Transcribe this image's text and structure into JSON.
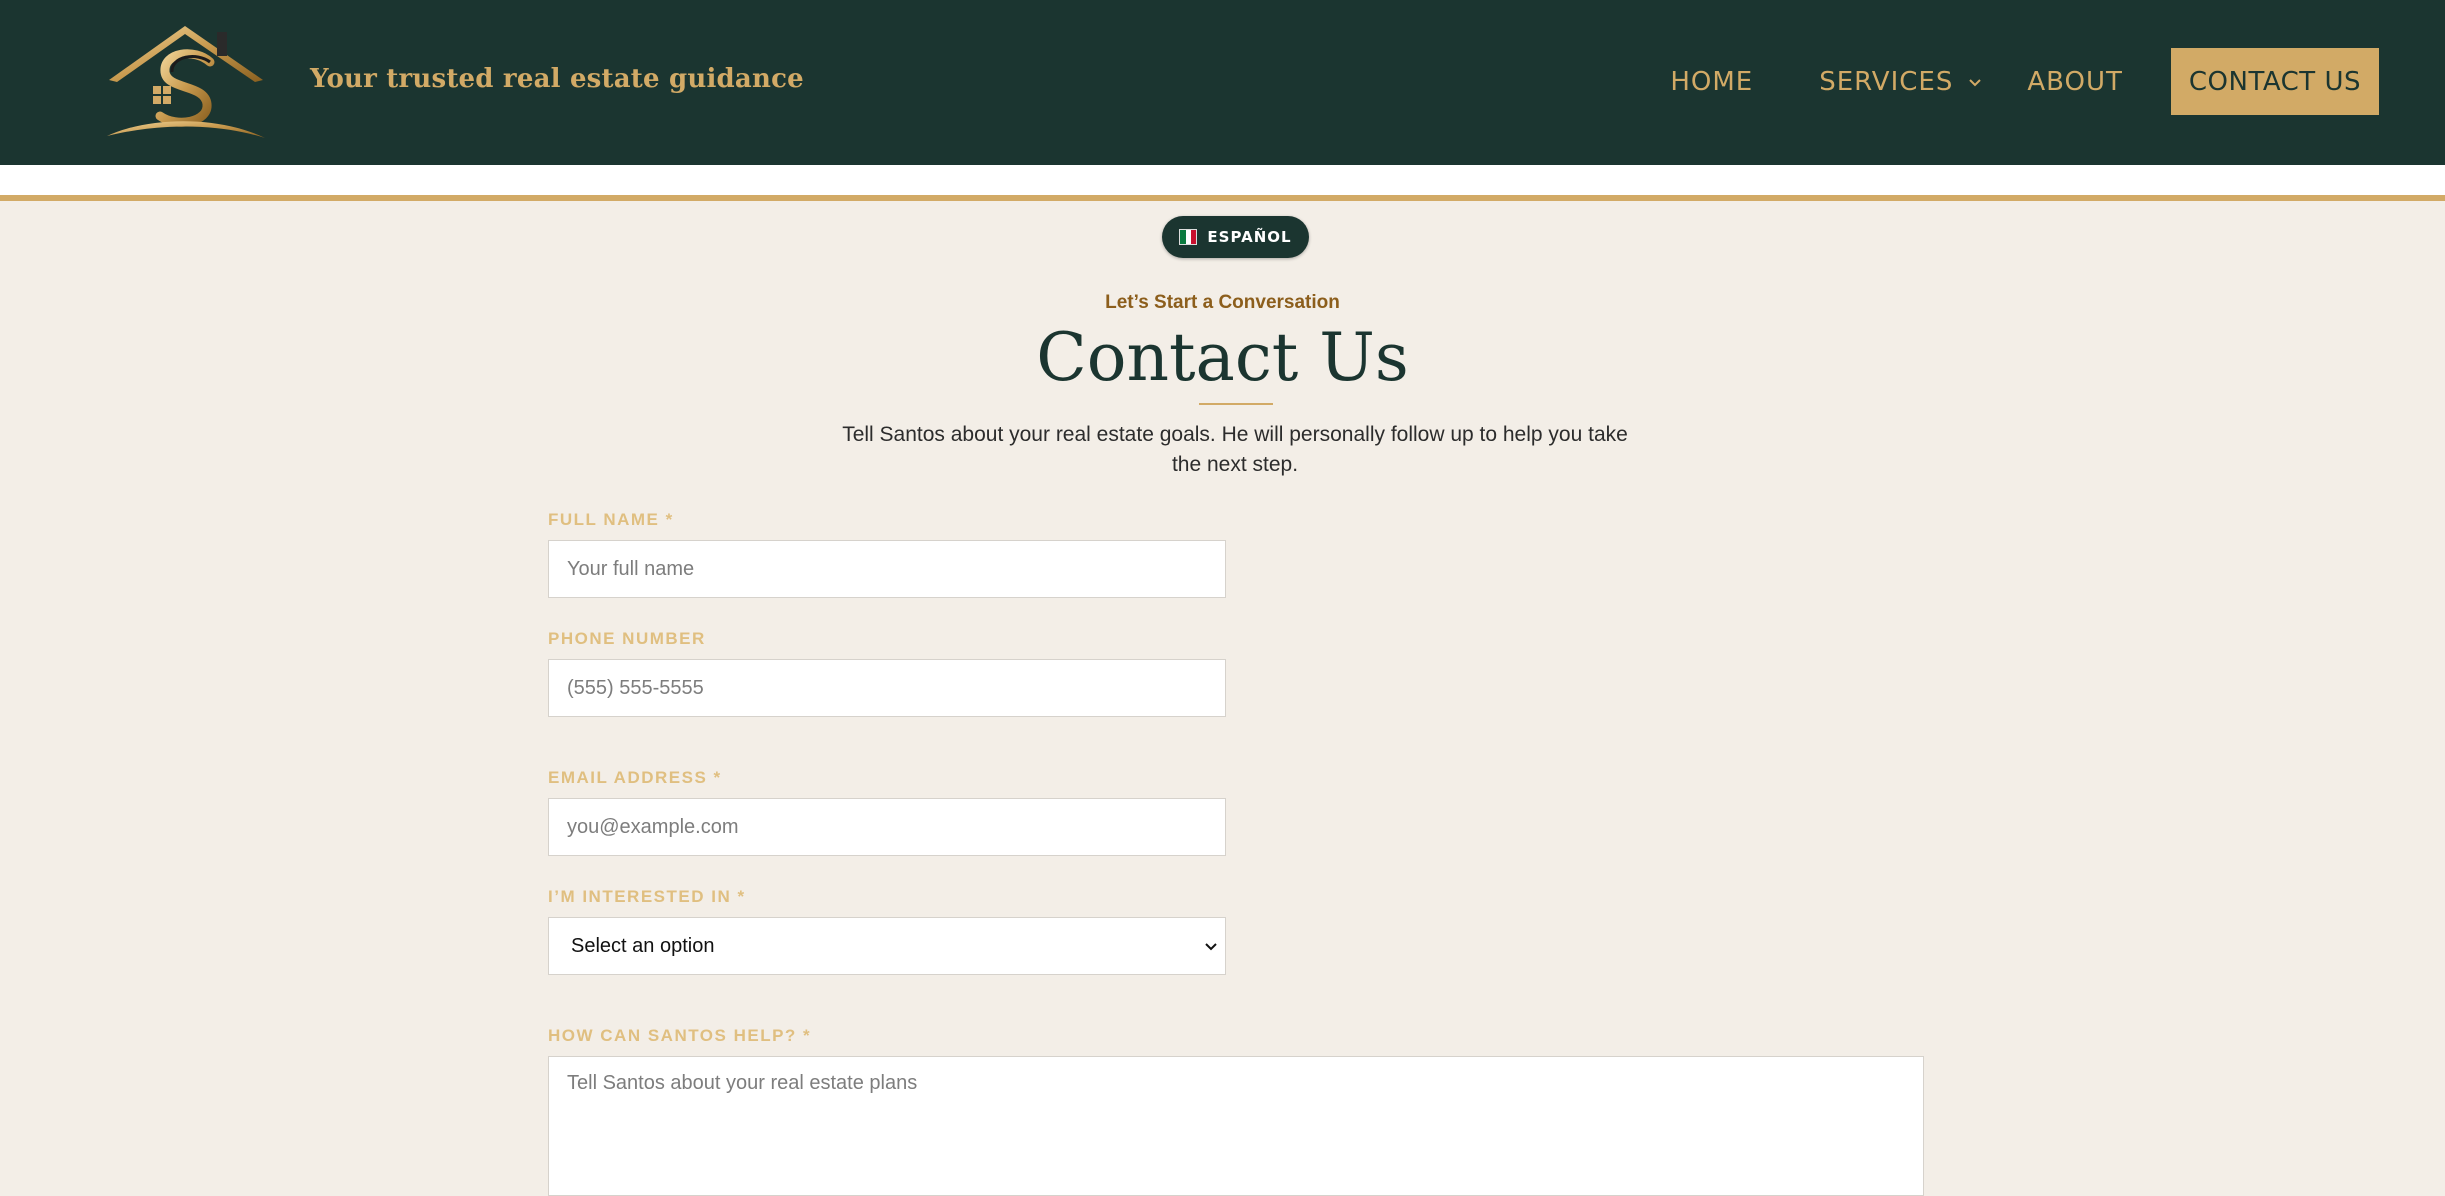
{
  "header": {
    "tagline": "Your trusted real estate guidance",
    "nav": {
      "home": "HOME",
      "services": "SERVICES",
      "about": "ABOUT",
      "contact": "CONTACT US"
    }
  },
  "language_toggle": {
    "label": "ESPAÑOL",
    "icon": "mexico-flag-icon"
  },
  "hero": {
    "eyebrow": "Let’s Start a Conversation",
    "title": "Contact Us",
    "intro": "Tell Santos about your real estate goals. He will personally follow up to help you take the next step."
  },
  "form": {
    "full_name": {
      "label": "FULL NAME *",
      "placeholder": "Your full name"
    },
    "phone": {
      "label": "PHONE NUMBER",
      "placeholder": "(555) 555-5555"
    },
    "email": {
      "label": "EMAIL ADDRESS *",
      "placeholder": "you@example.com"
    },
    "interest": {
      "label": "I’M INTERESTED IN *",
      "selected": "Select an option"
    },
    "message": {
      "label": "HOW CAN SANTOS HELP? *",
      "placeholder": "Tell Santos about your real estate plans"
    }
  },
  "colors": {
    "header_bg": "#1b3530",
    "gold": "#d2aa66",
    "page_bg": "#f3eee7",
    "eyebrow": "#8c5e1c"
  }
}
